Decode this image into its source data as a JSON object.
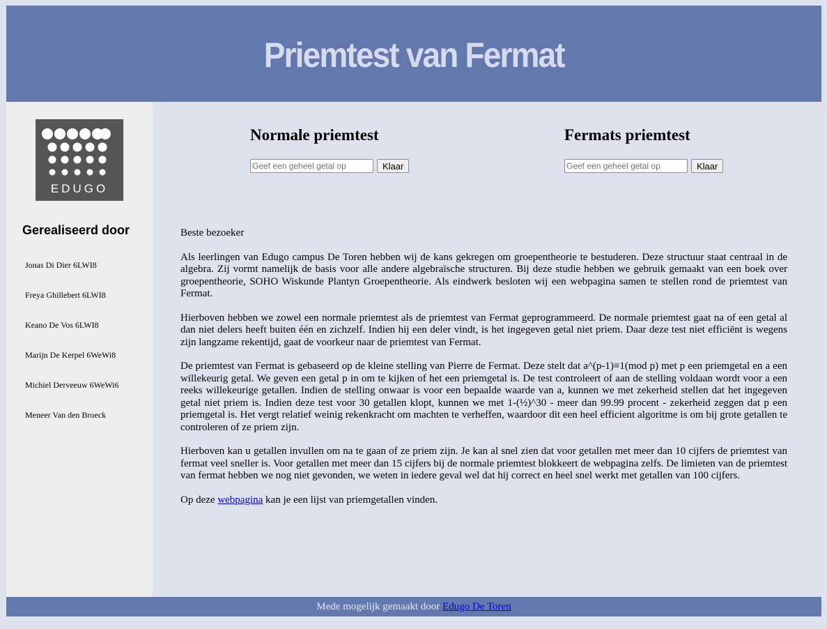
{
  "header": {
    "title": "Priemtest van Fermat"
  },
  "sidebar": {
    "logo_text": "EDUGO",
    "credits_title": "Gerealiseerd door",
    "credits": [
      "Jonas Di Dier 6LWI8",
      "Freya Ghillebert 6LWI8",
      "Keano De Vos 6LWI8",
      "Marijn De Kerpel 6WeWi8",
      "Michiel Derveeuw 6WeWi6",
      "Meneer Van den Broeck"
    ]
  },
  "testers": {
    "normal": {
      "title": "Normale priemtest",
      "placeholder": "Geef een geheel getal op",
      "value": "",
      "button": "Klaar"
    },
    "fermat": {
      "title": "Fermats priemtest",
      "placeholder": "Geef een geheel getal op",
      "value": "",
      "button": "Klaar"
    }
  },
  "content": {
    "greeting": "Beste bezoeker",
    "p1": "Als leerlingen van Edugo campus De Toren hebben wij de kans gekregen om groepentheorie te bestuderen. Deze structuur staat centraal in de algebra. Zij vormt namelijk de basis voor alle andere algebraïsche structuren. Bij deze studie hebben we gebruik gemaakt van een boek over groepentheorie, SOHO Wiskunde Plantyn Groepentheorie. Als eindwerk besloten wij een webpagina samen te stellen rond de priemtest van Fermat.",
    "p2": "Hierboven hebben we zowel een normale priemtest als de priemtest van Fermat geprogrammeerd. De normale priemtest gaat na of een getal al dan niet delers heeft buiten één en zichzelf. Indien hij een deler vindt, is het ingegeven getal niet priem. Daar deze test niet efficiënt is wegens zijn langzame rekentijd, gaat de voorkeur naar de priemtest van Fermat.",
    "p3": "De priemtest van Fermat is gebaseerd op de kleine stelling van Pierre de Fermat. Deze stelt dat a^(p-1)≡1(mod p) met p een priemgetal en a een willekeurig getal. We geven een getal p in om te kijken of het een priemgetal is. De test controleert of aan de stelling voldaan wordt voor a een reeks willekeurige getallen. Indien de stelling onwaar is voor een bepaalde waarde van a, kunnen we met zekerheid stellen dat het ingegeven getal niet priem is. Indien deze test voor 30 getallen klopt, kunnen we met 1-(½)^30 - meer dan 99.99 procent - zekerheid zeggen dat p een priemgetal is. Het vergt relatief weinig rekenkracht om machten te verheffen, waardoor dit een heel efficient algoritme is om bij grote getallen te controleren of ze priem zijn.",
    "p4": "Hierboven kan u getallen invullen om na te gaan of ze priem zijn. Je kan al snel zien dat voor getallen met meer dan 10 cijfers de priemtest van fermat veel sneller is. Voor getallen met meer dan 15 cijfers bij de normale priemtest blokkeert de webpagina zelfs. De limieten van de priemtest van fermat hebben we nog niet gevonden, we weten in iedere geval wel dat hij correct en heel snel werkt met getallen van 100 cijfers.",
    "p5_before": "Op deze ",
    "p5_link": "webpagina",
    "p5_after": " kan je een lijst van priemgetallen vinden."
  },
  "footer": {
    "text": "Mede mogelijk gemaakt door ",
    "link": "Edugo De Toren"
  },
  "colors": {
    "header_bg": "#6379ad",
    "page_bg": "#dde2ed",
    "sidebar_bg": "#eeeeee",
    "logo_bg": "#555555",
    "link": "#0000ee"
  }
}
